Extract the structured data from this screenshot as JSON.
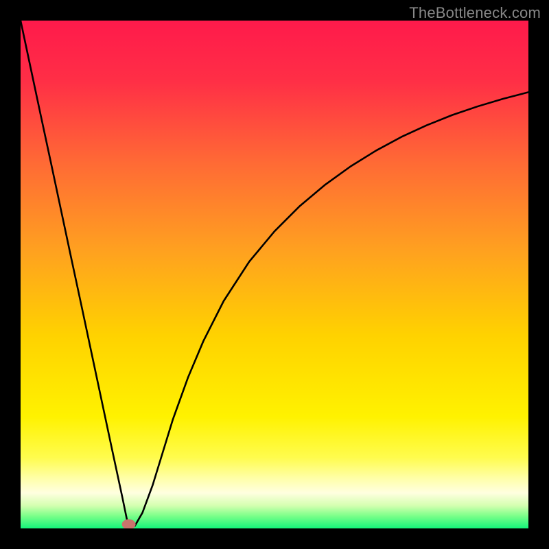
{
  "attribution": "TheBottleneck.com",
  "chart_data": {
    "type": "line",
    "title": "",
    "xlabel": "",
    "ylabel": "",
    "xlim": [
      0,
      100
    ],
    "ylim": [
      0,
      100
    ],
    "gradient_stops": [
      {
        "offset": 0.0,
        "color": "#ff1a4b"
      },
      {
        "offset": 0.12,
        "color": "#ff2f46"
      },
      {
        "offset": 0.28,
        "color": "#ff6a35"
      },
      {
        "offset": 0.45,
        "color": "#ffa020"
      },
      {
        "offset": 0.62,
        "color": "#ffd200"
      },
      {
        "offset": 0.78,
        "color": "#fff200"
      },
      {
        "offset": 0.86,
        "color": "#fffc4d"
      },
      {
        "offset": 0.9,
        "color": "#ffffa6"
      },
      {
        "offset": 0.93,
        "color": "#ffffe0"
      },
      {
        "offset": 0.955,
        "color": "#d4ffb0"
      },
      {
        "offset": 0.975,
        "color": "#7dff8a"
      },
      {
        "offset": 1.0,
        "color": "#14f57a"
      }
    ],
    "series": [
      {
        "name": "curve",
        "x": [
          0,
          2,
          4,
          6,
          8,
          10,
          12,
          14,
          16,
          18,
          20,
          21.3,
          22.5,
          24,
          26,
          28,
          30,
          33,
          36,
          40,
          45,
          50,
          55,
          60,
          65,
          70,
          75,
          80,
          85,
          90,
          95,
          100
        ],
        "y": [
          100,
          90.6,
          81.2,
          71.9,
          62.5,
          53.1,
          43.8,
          34.4,
          25.0,
          15.6,
          6.3,
          0.0,
          0.5,
          3.1,
          8.5,
          15.0,
          21.5,
          29.8,
          36.9,
          44.8,
          52.5,
          58.5,
          63.5,
          67.7,
          71.3,
          74.4,
          77.1,
          79.4,
          81.4,
          83.1,
          84.6,
          85.9
        ]
      }
    ],
    "marker": {
      "x": 21.3,
      "y": 0.8,
      "rx": 1.35,
      "ry": 1.0,
      "color": "#c9746c"
    }
  }
}
